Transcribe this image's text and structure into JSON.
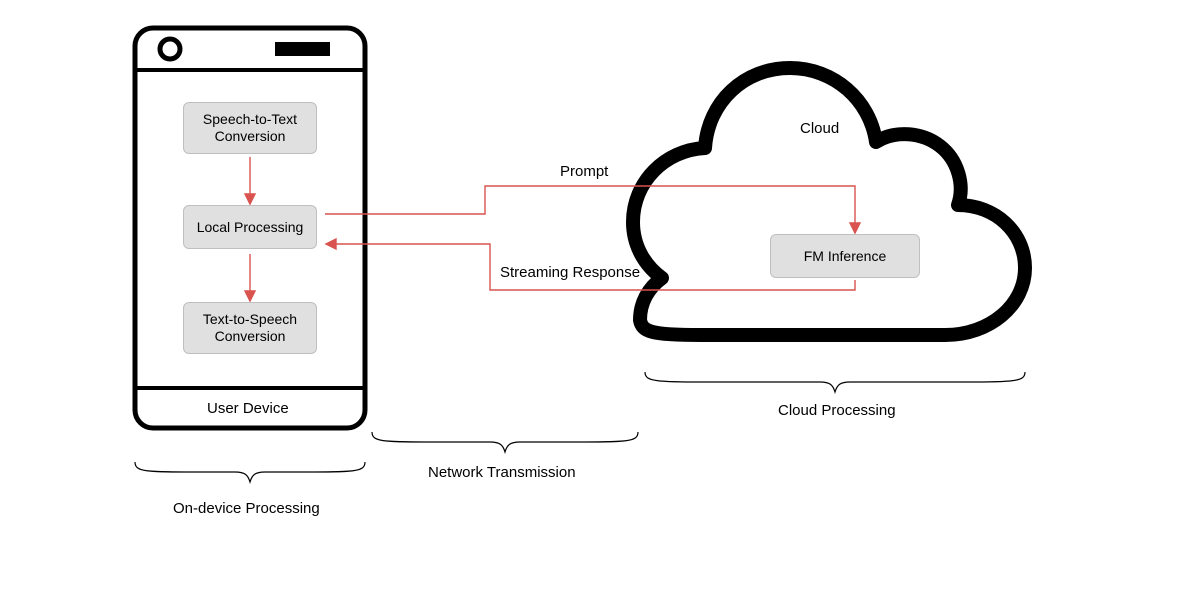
{
  "device": {
    "title": "User Device",
    "blocks": {
      "stt": "Speech-to-Text\nConversion",
      "local": "Local Processing",
      "tts": "Text-to-Speech\nConversion"
    },
    "section_label": "On-device Processing"
  },
  "cloud": {
    "title": "Cloud",
    "block": "FM Inference",
    "section_label": "Cloud Processing"
  },
  "network": {
    "prompt": "Prompt",
    "response": "Streaming Response",
    "section_label": "Network Transmission"
  },
  "colors": {
    "arrow": "#d9534f",
    "brace": "#000000"
  }
}
